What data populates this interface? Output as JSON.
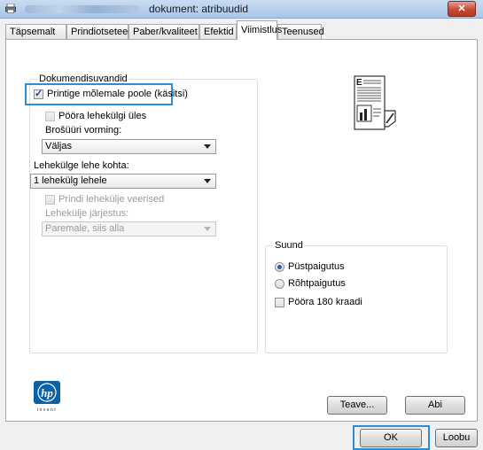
{
  "window": {
    "title": "dokument: atribuudid",
    "close_glyph": "✕"
  },
  "tabs": [
    {
      "label": "Täpsemalt",
      "active": false
    },
    {
      "label": "Prindiotseteed",
      "active": false
    },
    {
      "label": "Paber/kvaliteet",
      "active": false
    },
    {
      "label": "Efektid",
      "active": false
    },
    {
      "label": "Viimistlus",
      "active": true
    },
    {
      "label": "Teenused",
      "active": false
    }
  ],
  "document_options": {
    "group_title": "Dokumendisuvandid",
    "print_both_sides": {
      "label": "Printige mõlemale poole (käsitsi)",
      "checked": true
    },
    "flip_pages_up": {
      "label": "Pööra lehekülgi üles",
      "checked": false,
      "enabled": false
    },
    "booklet_layout_label": "Brošüüri vorming:",
    "booklet_layout_value": "Väljas",
    "pages_per_sheet_label": "Lehekülge lehe kohta:",
    "pages_per_sheet_value": "1 lehekülg lehele",
    "print_page_borders": {
      "label": "Prindi lehekülje veerised",
      "checked": false,
      "enabled": false
    },
    "page_order_label": "Lehekülje järjestus:",
    "page_order_value": "Paremale, siis alla"
  },
  "orientation": {
    "group_title": "Suund",
    "options": [
      {
        "label": "Püstpaigutus",
        "selected": true
      },
      {
        "label": "Rõhtpaigutus",
        "selected": false
      }
    ],
    "rotate_180": {
      "label": "Pööra 180 kraadi",
      "checked": false
    }
  },
  "logo": {
    "brand": "hp",
    "tagline": "invent"
  },
  "buttons": {
    "about": "Teave...",
    "help": "Abi",
    "ok": "OK",
    "cancel": "Loobu"
  },
  "colors": {
    "highlight": "#2e8ed4",
    "hp_blue": "#0b61a4"
  }
}
